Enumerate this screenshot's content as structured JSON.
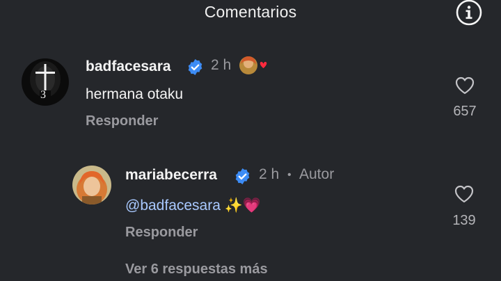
{
  "header": {
    "title": "Comentarios",
    "info_icon": "info-icon"
  },
  "comments": [
    {
      "username": "badfacesara",
      "verified": true,
      "time": "2 h",
      "text": "hermana otaku",
      "reply_label": "Responder",
      "likes": "657",
      "avatar_number": "3"
    },
    {
      "username": "mariabecerra",
      "verified": true,
      "time": "2 h",
      "author_label": "Autor",
      "mention": "@badfacesara",
      "text_suffix": " ✨💗",
      "reply_label": "Responder",
      "likes": "139"
    }
  ],
  "more_replies_label": "Ver 6 respuestas más",
  "colors": {
    "background": "#25272b",
    "verified": "#3d8cf5",
    "mention": "#a9c9ff",
    "muted": "#9a9a9f"
  }
}
